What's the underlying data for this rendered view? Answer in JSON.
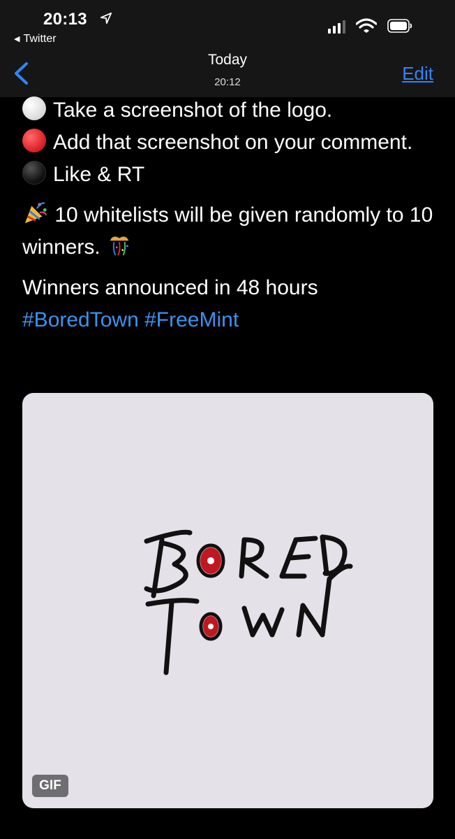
{
  "status_bar": {
    "time": "20:13",
    "back_app": "Twitter",
    "icons": [
      "location-arrow-icon",
      "cellular-signal-icon",
      "wifi-icon",
      "battery-icon"
    ]
  },
  "nav": {
    "title": "Today",
    "subtitle": "20:12",
    "edit_label": "Edit",
    "back_icon": "chevron-left-icon"
  },
  "tweet": {
    "line1": "Take a screenshot of the logo.",
    "line2": "Add that screenshot on your comment.",
    "line3": "Like & RT",
    "line4": "10 whitelists will be given randomly to 10 winners.",
    "line5": "Winners announced in 48 hours",
    "hashtags": [
      "#BoredTown",
      "#FreeMint"
    ]
  },
  "media": {
    "badge": "GIF",
    "logo_text": "BORED TOWN"
  },
  "colors": {
    "link": "#3a93f0",
    "edit": "#2f86f5",
    "media_bg": "#e4e2e8"
  }
}
